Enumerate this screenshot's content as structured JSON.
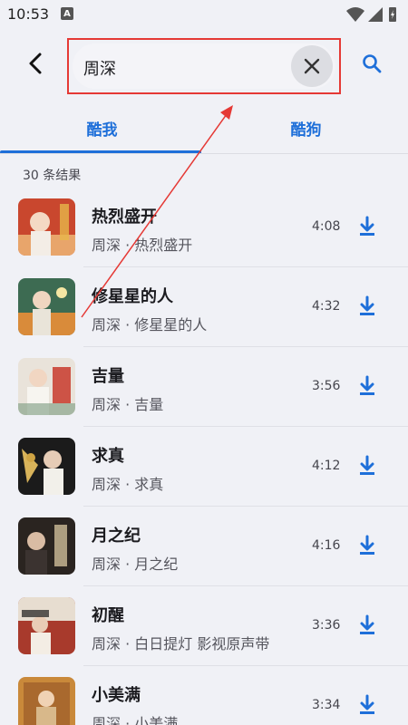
{
  "status_bar": {
    "time": "10:53",
    "notification_badge": "A"
  },
  "search": {
    "query": "周深",
    "clear_icon": "close-icon",
    "search_icon": "search-icon"
  },
  "tabs": [
    {
      "label": "酷我",
      "active": true
    },
    {
      "label": "酷狗",
      "active": false
    }
  ],
  "result_count": "30 条结果",
  "accent_color": "#1e6fd9",
  "highlight_color": "#e53935",
  "songs": [
    {
      "title": "热烈盛开",
      "subtitle": "周深 · 热烈盛开",
      "duration": "4:08"
    },
    {
      "title": "修星星的人",
      "subtitle": "周深 · 修星星的人",
      "duration": "4:32"
    },
    {
      "title": "吉量",
      "subtitle": "周深 · 吉量",
      "duration": "3:56"
    },
    {
      "title": "求真",
      "subtitle": "周深 · 求真",
      "duration": "4:12"
    },
    {
      "title": "月之纪",
      "subtitle": "周深 · 月之纪",
      "duration": "4:16"
    },
    {
      "title": "初醒",
      "subtitle": "周深 · 白日提灯 影视原声带",
      "duration": "3:36"
    },
    {
      "title": "小美满",
      "subtitle": "周深 · 小美满",
      "duration": "3:34"
    }
  ]
}
